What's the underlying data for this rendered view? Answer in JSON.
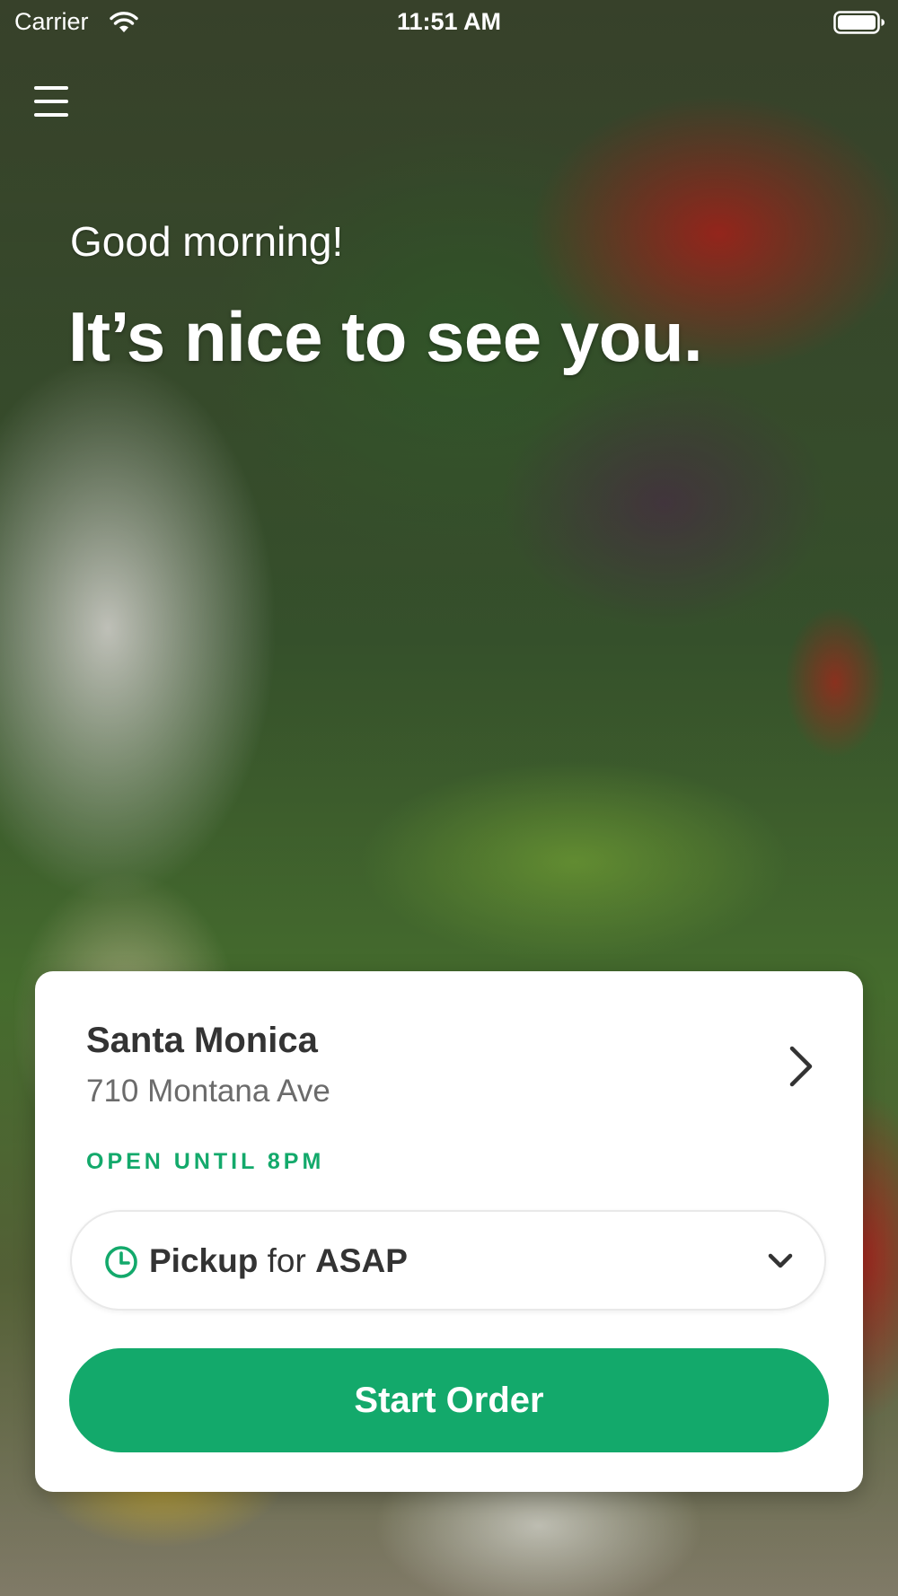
{
  "status_bar": {
    "carrier": "Carrier",
    "time": "11:51 AM",
    "icons": [
      "wifi-icon",
      "battery-icon"
    ]
  },
  "header": {
    "menu_icon": "hamburger-menu-icon"
  },
  "hero": {
    "greeting": "Good morning!",
    "headline": "It’s nice to see you."
  },
  "location_card": {
    "name": "Santa Monica",
    "address": "710 Montana Ave",
    "hours": "OPEN UNTIL 8PM",
    "hours_color": "#13a96b",
    "chevron_icon": "chevron-right-icon"
  },
  "order_mode": {
    "mode": "Pickup",
    "connector": " for ",
    "time": "ASAP",
    "icon": "clock-icon",
    "dropdown_icon": "chevron-down-icon"
  },
  "actions": {
    "start_order_label": "Start Order",
    "accent_color": "#13a96b"
  }
}
